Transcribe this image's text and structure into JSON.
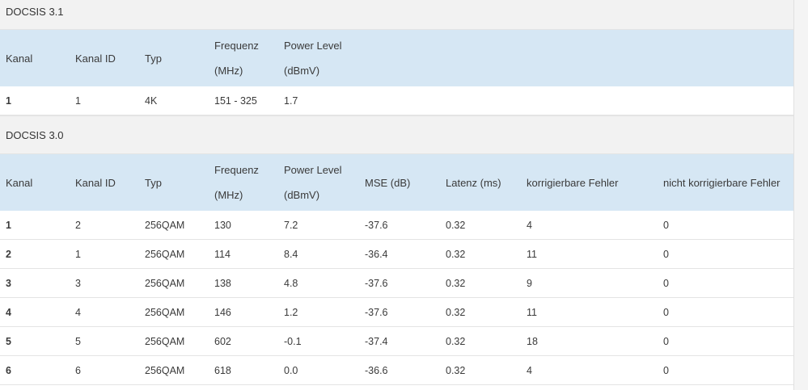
{
  "docsis31": {
    "title": "DOCSIS 3.1",
    "headers": {
      "kanal": "Kanal",
      "kanal_id": "Kanal ID",
      "typ": "Typ",
      "freq_line1": "Frequenz",
      "freq_line2": "(MHz)",
      "power_line1": "Power Level",
      "power_line2": "(dBmV)"
    },
    "rows": [
      {
        "kanal": "1",
        "kanal_id": "1",
        "typ": "4K",
        "freq": "151 - 325",
        "power": "1.7"
      }
    ]
  },
  "docsis30": {
    "title": "DOCSIS 3.0",
    "headers": {
      "kanal": "Kanal",
      "kanal_id": "Kanal ID",
      "typ": "Typ",
      "freq_line1": "Frequenz",
      "freq_line2": "(MHz)",
      "power_line1": "Power Level",
      "power_line2": "(dBmV)",
      "mse": "MSE (dB)",
      "latenz": "Latenz (ms)",
      "korr": "korrigierbare Fehler",
      "nicht_korr": "nicht korrigierbare Fehler"
    },
    "rows": [
      {
        "kanal": "1",
        "kanal_id": "2",
        "typ": "256QAM",
        "freq": "130",
        "power": "7.2",
        "mse": "-37.6",
        "latenz": "0.32",
        "korr": "4",
        "nicht_korr": "0"
      },
      {
        "kanal": "2",
        "kanal_id": "1",
        "typ": "256QAM",
        "freq": "114",
        "power": "8.4",
        "mse": "-36.4",
        "latenz": "0.32",
        "korr": "11",
        "nicht_korr": "0"
      },
      {
        "kanal": "3",
        "kanal_id": "3",
        "typ": "256QAM",
        "freq": "138",
        "power": "4.8",
        "mse": "-37.6",
        "latenz": "0.32",
        "korr": "9",
        "nicht_korr": "0"
      },
      {
        "kanal": "4",
        "kanal_id": "4",
        "typ": "256QAM",
        "freq": "146",
        "power": "1.2",
        "mse": "-37.6",
        "latenz": "0.32",
        "korr": "11",
        "nicht_korr": "0"
      },
      {
        "kanal": "5",
        "kanal_id": "5",
        "typ": "256QAM",
        "freq": "602",
        "power": "-0.1",
        "mse": "-37.4",
        "latenz": "0.32",
        "korr": "18",
        "nicht_korr": "0"
      },
      {
        "kanal": "6",
        "kanal_id": "6",
        "typ": "256QAM",
        "freq": "618",
        "power": "0.0",
        "mse": "-36.6",
        "latenz": "0.32",
        "korr": "4",
        "nicht_korr": "0"
      }
    ]
  }
}
